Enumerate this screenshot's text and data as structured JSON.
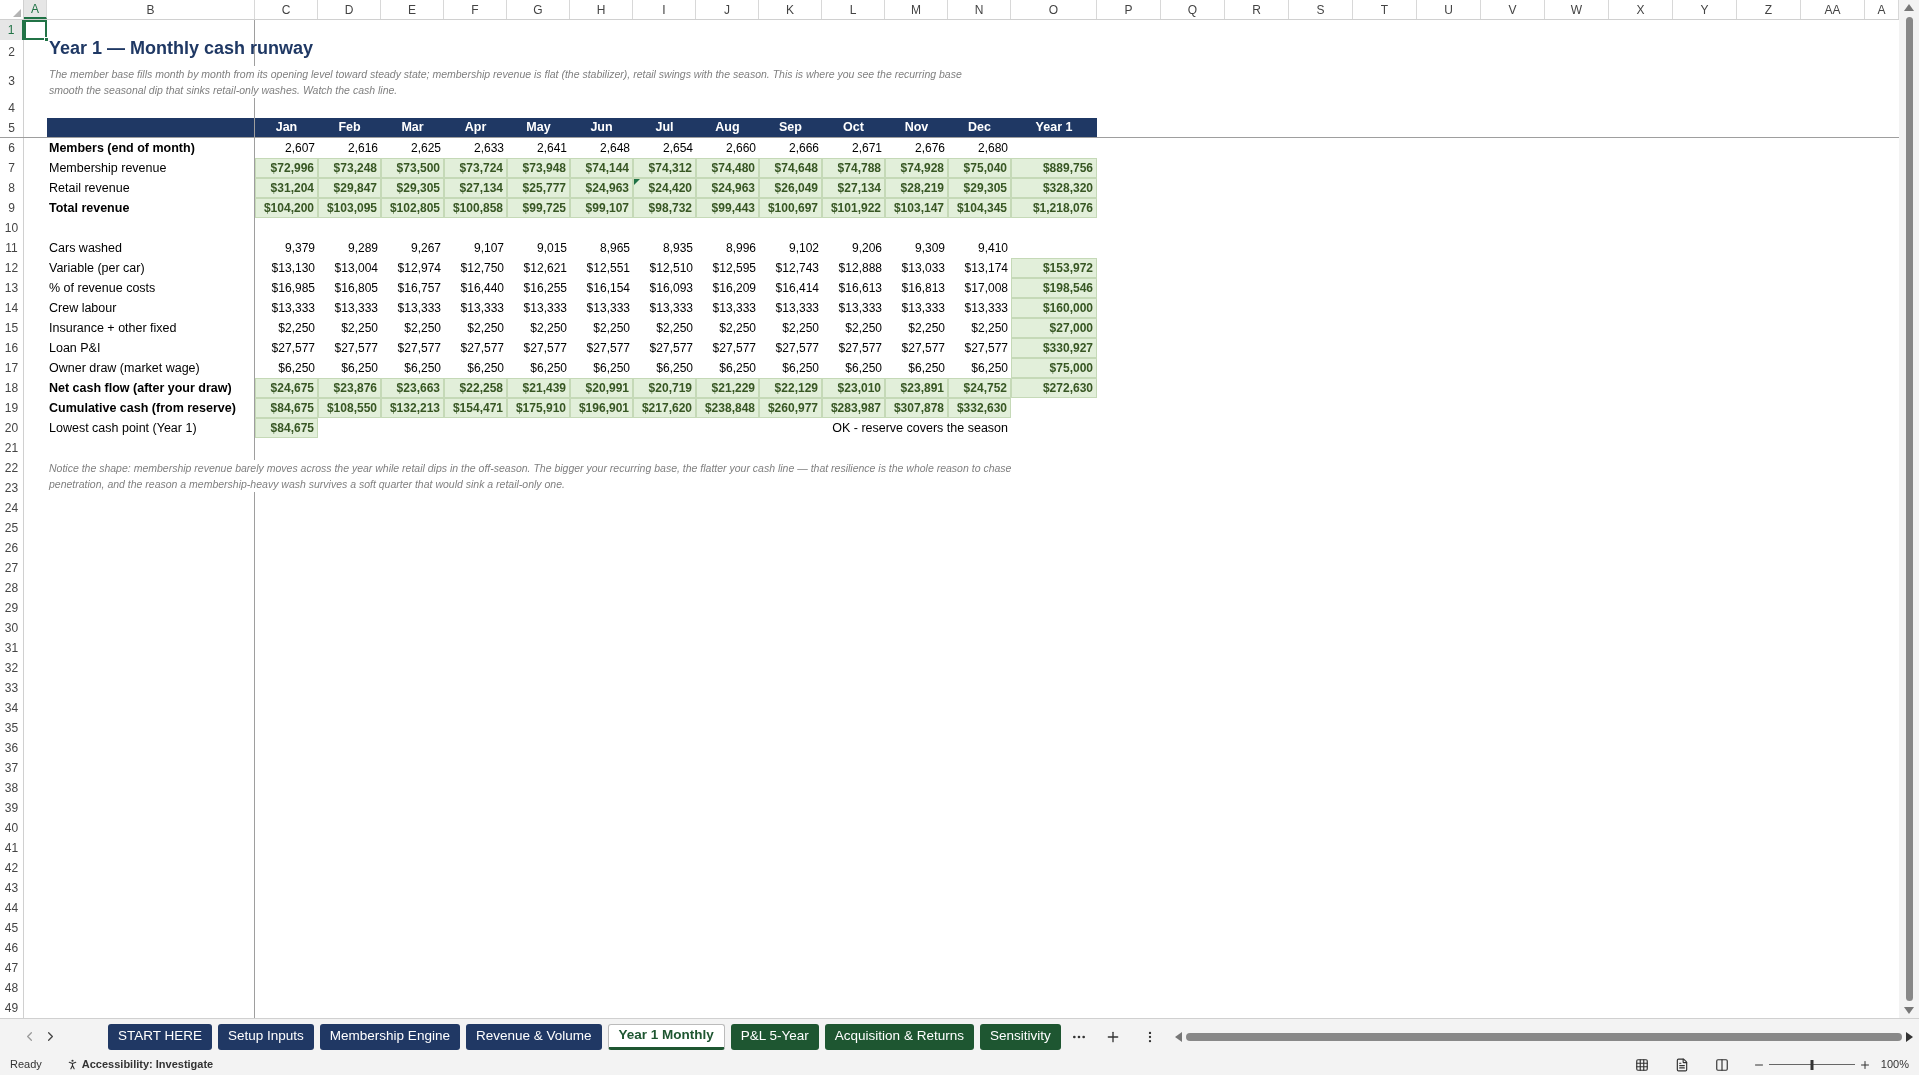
{
  "column_headers": [
    {
      "label": "A",
      "selected": true
    },
    {
      "label": "B",
      "selected": false
    },
    {
      "label": "C",
      "selected": false
    },
    {
      "label": "D",
      "selected": false
    },
    {
      "label": "E",
      "selected": false
    },
    {
      "label": "F",
      "selected": false
    },
    {
      "label": "G",
      "selected": false
    },
    {
      "label": "H",
      "selected": false
    },
    {
      "label": "I",
      "selected": false
    },
    {
      "label": "J",
      "selected": false
    },
    {
      "label": "K",
      "selected": false
    },
    {
      "label": "L",
      "selected": false
    },
    {
      "label": "M",
      "selected": false
    },
    {
      "label": "N",
      "selected": false
    },
    {
      "label": "O",
      "selected": false
    },
    {
      "label": "P",
      "selected": false
    },
    {
      "label": "Q",
      "selected": false
    },
    {
      "label": "R",
      "selected": false
    },
    {
      "label": "S",
      "selected": false
    },
    {
      "label": "T",
      "selected": false
    },
    {
      "label": "U",
      "selected": false
    },
    {
      "label": "V",
      "selected": false
    },
    {
      "label": "W",
      "selected": false
    },
    {
      "label": "X",
      "selected": false
    },
    {
      "label": "Y",
      "selected": false
    },
    {
      "label": "Z",
      "selected": false
    },
    {
      "label": "AA",
      "selected": false
    },
    {
      "label": "A",
      "selected": false
    }
  ],
  "row_headers": [
    {
      "label": "1",
      "selected": true
    },
    {
      "label": "2",
      "selected": false
    },
    {
      "label": "3",
      "selected": false
    },
    {
      "label": "4",
      "selected": false
    },
    {
      "label": "5",
      "selected": false
    },
    {
      "label": "6",
      "selected": false
    },
    {
      "label": "7",
      "selected": false
    },
    {
      "label": "8",
      "selected": false
    },
    {
      "label": "9",
      "selected": false
    },
    {
      "label": "10",
      "selected": false
    },
    {
      "label": "11",
      "selected": false
    },
    {
      "label": "12",
      "selected": false
    },
    {
      "label": "13",
      "selected": false
    },
    {
      "label": "14",
      "selected": false
    },
    {
      "label": "15",
      "selected": false
    },
    {
      "label": "16",
      "selected": false
    },
    {
      "label": "17",
      "selected": false
    },
    {
      "label": "18",
      "selected": false
    },
    {
      "label": "19",
      "selected": false
    },
    {
      "label": "20",
      "selected": false
    },
    {
      "label": "21",
      "selected": false
    },
    {
      "label": "22",
      "selected": false
    },
    {
      "label": "23",
      "selected": false
    },
    {
      "label": "24",
      "selected": false
    },
    {
      "label": "25",
      "selected": false
    },
    {
      "label": "26",
      "selected": false
    },
    {
      "label": "27",
      "selected": false
    },
    {
      "label": "28",
      "selected": false
    },
    {
      "label": "29",
      "selected": false
    },
    {
      "label": "30",
      "selected": false
    },
    {
      "label": "31",
      "selected": false
    },
    {
      "label": "32",
      "selected": false
    },
    {
      "label": "33",
      "selected": false
    },
    {
      "label": "34",
      "selected": false
    },
    {
      "label": "35",
      "selected": false
    },
    {
      "label": "36",
      "selected": false
    },
    {
      "label": "37",
      "selected": false
    },
    {
      "label": "38",
      "selected": false
    },
    {
      "label": "39",
      "selected": false
    },
    {
      "label": "40",
      "selected": false
    },
    {
      "label": "41",
      "selected": false
    },
    {
      "label": "42",
      "selected": false
    },
    {
      "label": "43",
      "selected": false
    },
    {
      "label": "44",
      "selected": false
    },
    {
      "label": "45",
      "selected": false
    },
    {
      "label": "46",
      "selected": false
    },
    {
      "label": "47",
      "selected": false
    },
    {
      "label": "48",
      "selected": false
    },
    {
      "label": "49",
      "selected": false
    }
  ],
  "title": "Year 1 — Monthly cash runway",
  "intro": "The member base fills month by month from its opening level toward steady state; membership revenue is flat (the stabilizer), retail swings with the season. This is where you see the recurring base smooth the seasonal dip that sinks retail-only washes. Watch the cash line.",
  "table": {
    "months": [
      "Jan",
      "Feb",
      "Mar",
      "Apr",
      "May",
      "Jun",
      "Jul",
      "Aug",
      "Sep",
      "Oct",
      "Nov",
      "Dec"
    ],
    "total_heading": "Year 1",
    "revenue_rows": [
      {
        "label": "Members (end of month)",
        "bold": true,
        "shaded": false,
        "values": [
          "2,607",
          "2,616",
          "2,625",
          "2,633",
          "2,641",
          "2,648",
          "2,654",
          "2,660",
          "2,666",
          "2,671",
          "2,676",
          "2,680"
        ]
      },
      {
        "label": "Membership revenue",
        "bold": false,
        "shaded": true,
        "values": [
          "$72,996",
          "$73,248",
          "$73,500",
          "$73,724",
          "$73,948",
          "$74,144",
          "$74,312",
          "$74,480",
          "$74,648",
          "$74,788",
          "$74,928",
          "$75,040"
        ],
        "total": "$889,756"
      },
      {
        "label": "Retail revenue",
        "bold": false,
        "shaded": true,
        "values": [
          "$31,204",
          "$29,847",
          "$29,305",
          "$27,134",
          "$25,777",
          "$24,963",
          "$24,420",
          "$24,963",
          "$26,049",
          "$27,134",
          "$28,219",
          "$29,305"
        ],
        "total": "$328,320",
        "flagged": [
          false,
          false,
          false,
          false,
          false,
          false,
          true,
          false,
          false,
          false,
          false,
          false
        ]
      },
      {
        "label": "Total revenue",
        "bold": true,
        "shaded": true,
        "values": [
          "$104,200",
          "$103,095",
          "$102,805",
          "$100,858",
          "$99,725",
          "$99,107",
          "$98,732",
          "$99,443",
          "$100,697",
          "$101,922",
          "$103,147",
          "$104,345"
        ],
        "total": "$1,218,076"
      }
    ],
    "cost_rows": [
      {
        "label": "Cars washed",
        "bold": false,
        "shaded": false,
        "values": [
          "9,379",
          "9,289",
          "9,267",
          "9,107",
          "9,015",
          "8,965",
          "8,935",
          "8,996",
          "9,102",
          "9,206",
          "9,309",
          "9,410"
        ]
      },
      {
        "label": "Variable (per car)",
        "bold": false,
        "shaded": false,
        "values": [
          "$13,130",
          "$13,004",
          "$12,974",
          "$12,750",
          "$12,621",
          "$12,551",
          "$12,510",
          "$12,595",
          "$12,743",
          "$12,888",
          "$13,033",
          "$13,174"
        ],
        "total": "$153,972"
      },
      {
        "label": "% of revenue costs",
        "bold": false,
        "shaded": false,
        "values": [
          "$16,985",
          "$16,805",
          "$16,757",
          "$16,440",
          "$16,255",
          "$16,154",
          "$16,093",
          "$16,209",
          "$16,414",
          "$16,613",
          "$16,813",
          "$17,008"
        ],
        "total": "$198,546"
      },
      {
        "label": "Crew labour",
        "bold": false,
        "shaded": false,
        "values": [
          "$13,333",
          "$13,333",
          "$13,333",
          "$13,333",
          "$13,333",
          "$13,333",
          "$13,333",
          "$13,333",
          "$13,333",
          "$13,333",
          "$13,333",
          "$13,333"
        ],
        "total": "$160,000"
      },
      {
        "label": "Insurance + other fixed",
        "bold": false,
        "shaded": false,
        "values": [
          "$2,250",
          "$2,250",
          "$2,250",
          "$2,250",
          "$2,250",
          "$2,250",
          "$2,250",
          "$2,250",
          "$2,250",
          "$2,250",
          "$2,250",
          "$2,250"
        ],
        "total": "$27,000"
      },
      {
        "label": "Loan P&I",
        "bold": false,
        "shaded": false,
        "values": [
          "$27,577",
          "$27,577",
          "$27,577",
          "$27,577",
          "$27,577",
          "$27,577",
          "$27,577",
          "$27,577",
          "$27,577",
          "$27,577",
          "$27,577",
          "$27,577"
        ],
        "total": "$330,927"
      },
      {
        "label": "Owner draw (market wage)",
        "bold": false,
        "shaded": false,
        "values": [
          "$6,250",
          "$6,250",
          "$6,250",
          "$6,250",
          "$6,250",
          "$6,250",
          "$6,250",
          "$6,250",
          "$6,250",
          "$6,250",
          "$6,250",
          "$6,250"
        ],
        "total": "$75,000"
      },
      {
        "label": "Net cash flow (after your draw)",
        "bold": true,
        "shaded": true,
        "values": [
          "$24,675",
          "$23,876",
          "$23,663",
          "$22,258",
          "$21,439",
          "$20,991",
          "$20,719",
          "$21,229",
          "$22,129",
          "$23,010",
          "$23,891",
          "$24,752"
        ],
        "total": "$272,630"
      },
      {
        "label": "Cumulative cash (from reserve)",
        "bold": true,
        "shaded": true,
        "values": [
          "$84,675",
          "$108,550",
          "$132,213",
          "$154,471",
          "$175,910",
          "$196,901",
          "$217,620",
          "$238,848",
          "$260,977",
          "$283,987",
          "$307,878",
          "$332,630"
        ]
      }
    ],
    "lowest": {
      "label": "Lowest cash point (Year 1)",
      "value": "$84,675",
      "status": "OK - reserve covers the season"
    }
  },
  "note": "Notice the shape: membership revenue barely moves across the year while retail dips in the off-season. The bigger your recurring base, the flatter your cash line — that resilience is the whole reason to chase penetration, and the reason a membership-heavy wash survives a soft quarter that would sink a retail-only one.",
  "sheet_tabs": [
    {
      "label": "START HERE",
      "selected": false,
      "color": "#203864"
    },
    {
      "label": "Setup Inputs",
      "selected": false,
      "color": "#203864"
    },
    {
      "label": "Membership Engine",
      "selected": false,
      "color": "#203864"
    },
    {
      "label": "Revenue & Volume",
      "selected": false,
      "color": "#203864"
    },
    {
      "label": "Year 1 Monthly",
      "selected": true,
      "color": "#1e5631"
    },
    {
      "label": "P&L 5-Year",
      "selected": false,
      "color": "#1e5631"
    },
    {
      "label": "Acquisition & Returns",
      "selected": false,
      "color": "#1e5631"
    },
    {
      "label": "Sensitivity",
      "selected": false,
      "color": "#1e5631"
    }
  ],
  "status_bar": {
    "ready": "Ready",
    "accessibility": "Accessibility: Investigate",
    "zoom": "100%",
    "zoom_slider": {
      "level": 0.5
    }
  }
}
